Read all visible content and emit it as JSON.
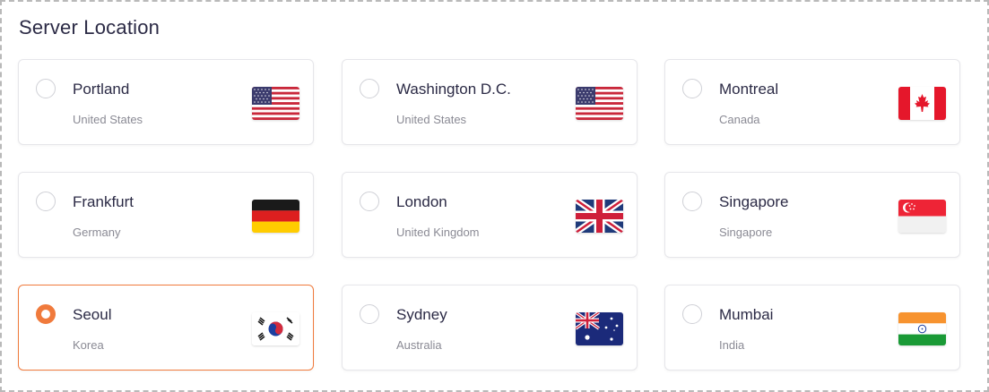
{
  "page": {
    "title": "Server Location"
  },
  "colors": {
    "accent": "#f07a3c",
    "text": "#2b2a45",
    "muted": "#8a8a94"
  },
  "locations": [
    {
      "city": "Portland",
      "country": "United States",
      "flag": "us-flag-icon",
      "selected": false
    },
    {
      "city": "Washington D.C.",
      "country": "United States",
      "flag": "us-flag-icon",
      "selected": false
    },
    {
      "city": "Montreal",
      "country": "Canada",
      "flag": "canada-flag-icon",
      "selected": false
    },
    {
      "city": "Frankfurt",
      "country": "Germany",
      "flag": "germany-flag-icon",
      "selected": false
    },
    {
      "city": "London",
      "country": "United Kingdom",
      "flag": "uk-flag-icon",
      "selected": false
    },
    {
      "city": "Singapore",
      "country": "Singapore",
      "flag": "singapore-flag-icon",
      "selected": false
    },
    {
      "city": "Seoul",
      "country": "Korea",
      "flag": "korea-flag-icon",
      "selected": true
    },
    {
      "city": "Sydney",
      "country": "Australia",
      "flag": "australia-flag-icon",
      "selected": false
    },
    {
      "city": "Mumbai",
      "country": "India",
      "flag": "india-flag-icon",
      "selected": false
    }
  ]
}
